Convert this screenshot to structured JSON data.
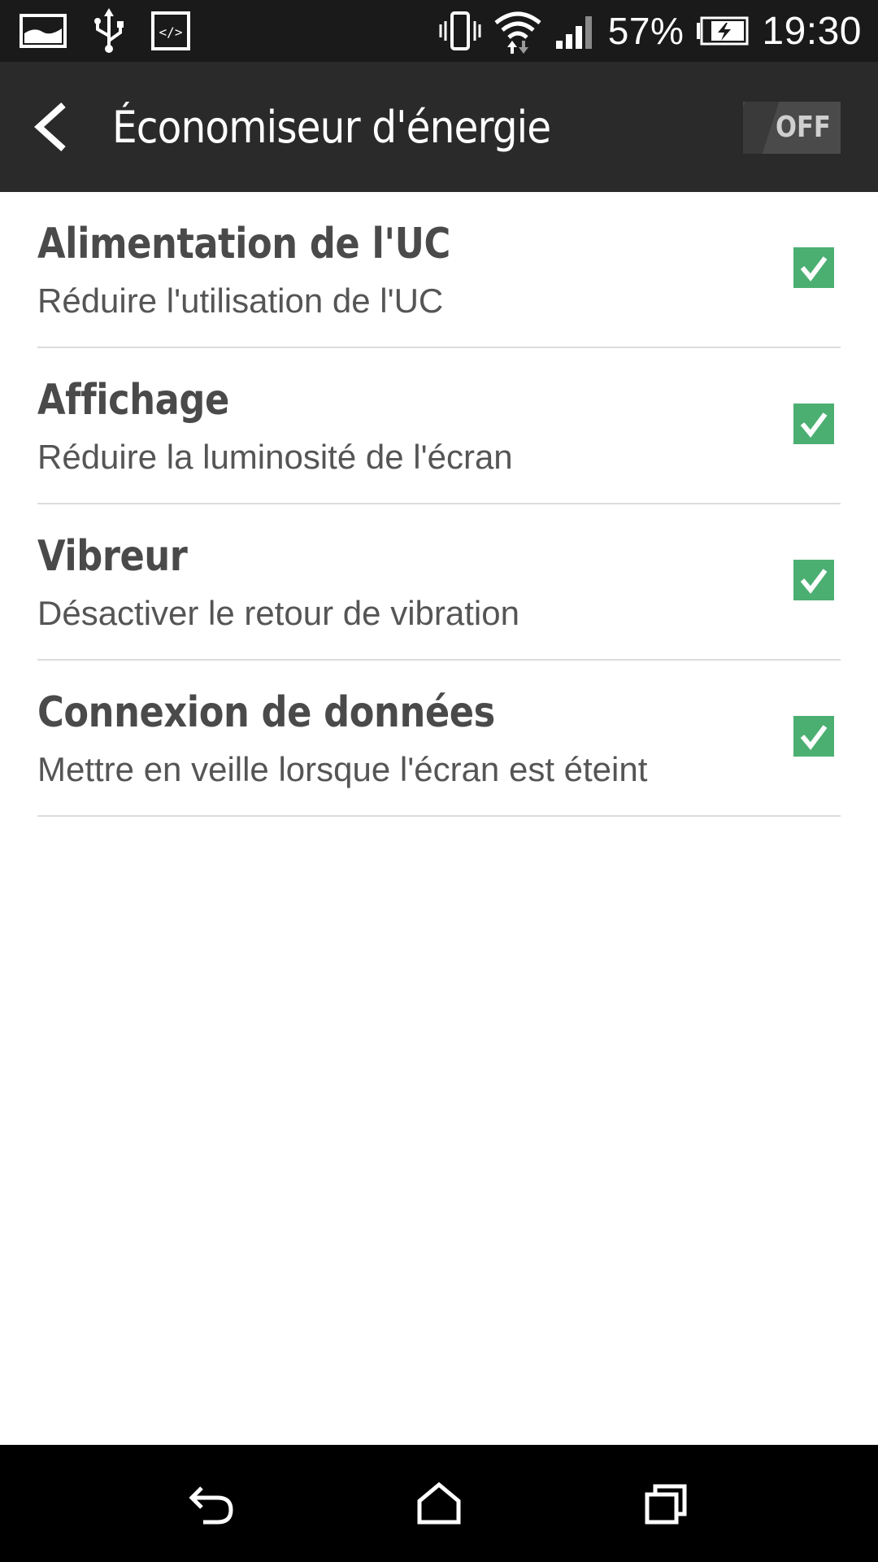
{
  "status_bar": {
    "battery_percent": "57%",
    "time": "19:30",
    "icons": [
      "image-notification-icon",
      "usb-icon",
      "developer-icon",
      "vibrate-icon",
      "wifi-icon",
      "signal-icon",
      "battery-charging-icon"
    ]
  },
  "header": {
    "title": "Économiseur d'énergie",
    "toggle": {
      "label": "OFF",
      "state": "off"
    }
  },
  "settings": [
    {
      "title": "Alimentation de l'UC",
      "subtitle": "Réduire l'utilisation de l'UC",
      "checked": true
    },
    {
      "title": "Affichage",
      "subtitle": "Réduire la luminosité de l'écran",
      "checked": true
    },
    {
      "title": "Vibreur",
      "subtitle": "Désactiver le retour de vibration",
      "checked": true
    },
    {
      "title": "Connexion de données",
      "subtitle": "Mettre en veille lorsque l'écran est éteint",
      "checked": true
    }
  ],
  "colors": {
    "status_bar": "#1a1a1a",
    "action_bar": "#2a2a2a",
    "checkbox_green": "#4caf72",
    "nav_bar": "#000000"
  },
  "nav_bar": {
    "icons": [
      "back-icon",
      "home-icon",
      "recent-apps-icon"
    ]
  }
}
